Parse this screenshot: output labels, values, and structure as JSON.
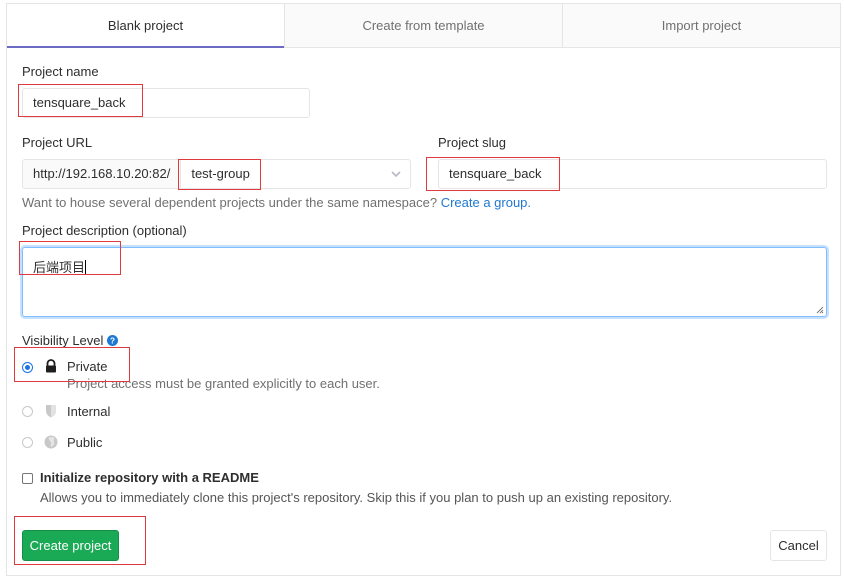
{
  "tabs": [
    {
      "label": "Blank project",
      "active": true
    },
    {
      "label": "Create from template",
      "active": false
    },
    {
      "label": "Import project",
      "active": false
    }
  ],
  "form": {
    "project_name": {
      "label": "Project name",
      "value": "tensquare_back"
    },
    "project_url": {
      "label": "Project URL",
      "prefix": "http://192.168.10.20:82/",
      "namespace": "test-group"
    },
    "project_slug": {
      "label": "Project slug",
      "value": "tensquare_back"
    },
    "namespace_help": {
      "text": "Want to house several dependent projects under the same namespace?",
      "link": "Create a group."
    },
    "description": {
      "label": "Project description (optional)",
      "value": "后端项目"
    },
    "visibility": {
      "label": "Visibility Level",
      "selected": "Private",
      "options": [
        {
          "label": "Private",
          "icon": "lock-icon",
          "description": "Project access must be granted explicitly to each user.",
          "checked": true
        },
        {
          "label": "Internal",
          "icon": "shield-icon",
          "checked": false
        },
        {
          "label": "Public",
          "icon": "globe-icon",
          "checked": false
        }
      ]
    },
    "readme": {
      "label": "Initialize repository with a README",
      "description": "Allows you to immediately clone this project's repository. Skip this if you plan to push up an existing repository.",
      "checked": false
    }
  },
  "actions": {
    "create_label": "Create project",
    "cancel_label": "Cancel"
  },
  "colors": {
    "accent": "#6b6bc4",
    "primary_button": "#1aaa55",
    "link": "#1f78d1",
    "annotation": "#e0393e"
  }
}
